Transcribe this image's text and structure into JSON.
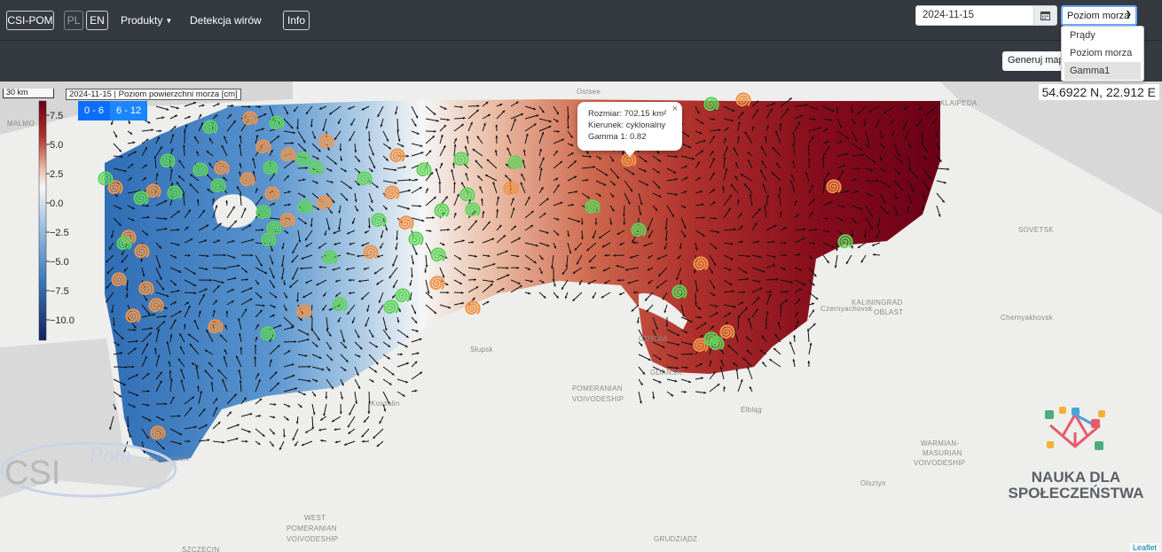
{
  "navbar": {
    "brand": "CSI-POM",
    "lang_pl": "PL",
    "lang_en": "EN",
    "products": "Produkty",
    "eddy_detection": "Detekcja wirów",
    "info": "Info"
  },
  "controls": {
    "date_value": "2024-11-15",
    "calendar_icon": "calendar-icon",
    "selected_layer": "Poziom morza",
    "layer_options": [
      "Prądy",
      "Poziom morza",
      "Gamma1"
    ],
    "highlighted_option": "Gamma1",
    "generate_button": "Generuj mapę"
  },
  "map": {
    "scale_label": "30 km",
    "legend_title": "2024-11-15 | Poziom powierzchni morza [cm]",
    "colorbar_ticks": [
      "7.5",
      "5.0",
      "2.5",
      "0.0",
      "−2.5",
      "−5.0",
      "−7.5",
      "−10.0"
    ],
    "range_buttons": [
      "0 - 6",
      "6 - 12"
    ],
    "coordinates": "54.6922 N, 22.912 E",
    "popup": {
      "size_label": "Rozmiar: 702.15 km²",
      "direction_label": "Kierunek: cyklonalny",
      "gamma_label": "Gamma 1: 0.82",
      "close": "×"
    },
    "place_labels": [
      "MALMO",
      "Ostsee",
      "KLAIPEDA",
      "SOVETSK",
      "KALININGRAD",
      "OBLAST",
      "Chernyakhovsk",
      "Słupsk",
      "GDYNIA",
      "GDANSK",
      "POMERANIAN",
      "VOIVODESHIP",
      "Koszalin",
      "Elbląg",
      "WARMIAN-",
      "MASURIAN",
      "VOIVODESHIP",
      "Olsztyn",
      "WEST",
      "POMERANIAN",
      "VOIVODESHIP",
      "GRUDZIĄDZ",
      "SZCZECIN",
      "Świnoujście",
      "Czernyachovsk"
    ],
    "attribution": "Leaflet",
    "logo_csi": "CSI",
    "logo_pom": "Pom",
    "nauka_line1": "NAUKA DLA",
    "nauka_line2": "SPOŁECZEŃSTWA"
  },
  "colors": {
    "navbar": "#343a40",
    "accent_blue": "#0d6efd",
    "eddy_cyclonic": "#f0954a",
    "eddy_anticyclonic": "#5fd35a"
  }
}
